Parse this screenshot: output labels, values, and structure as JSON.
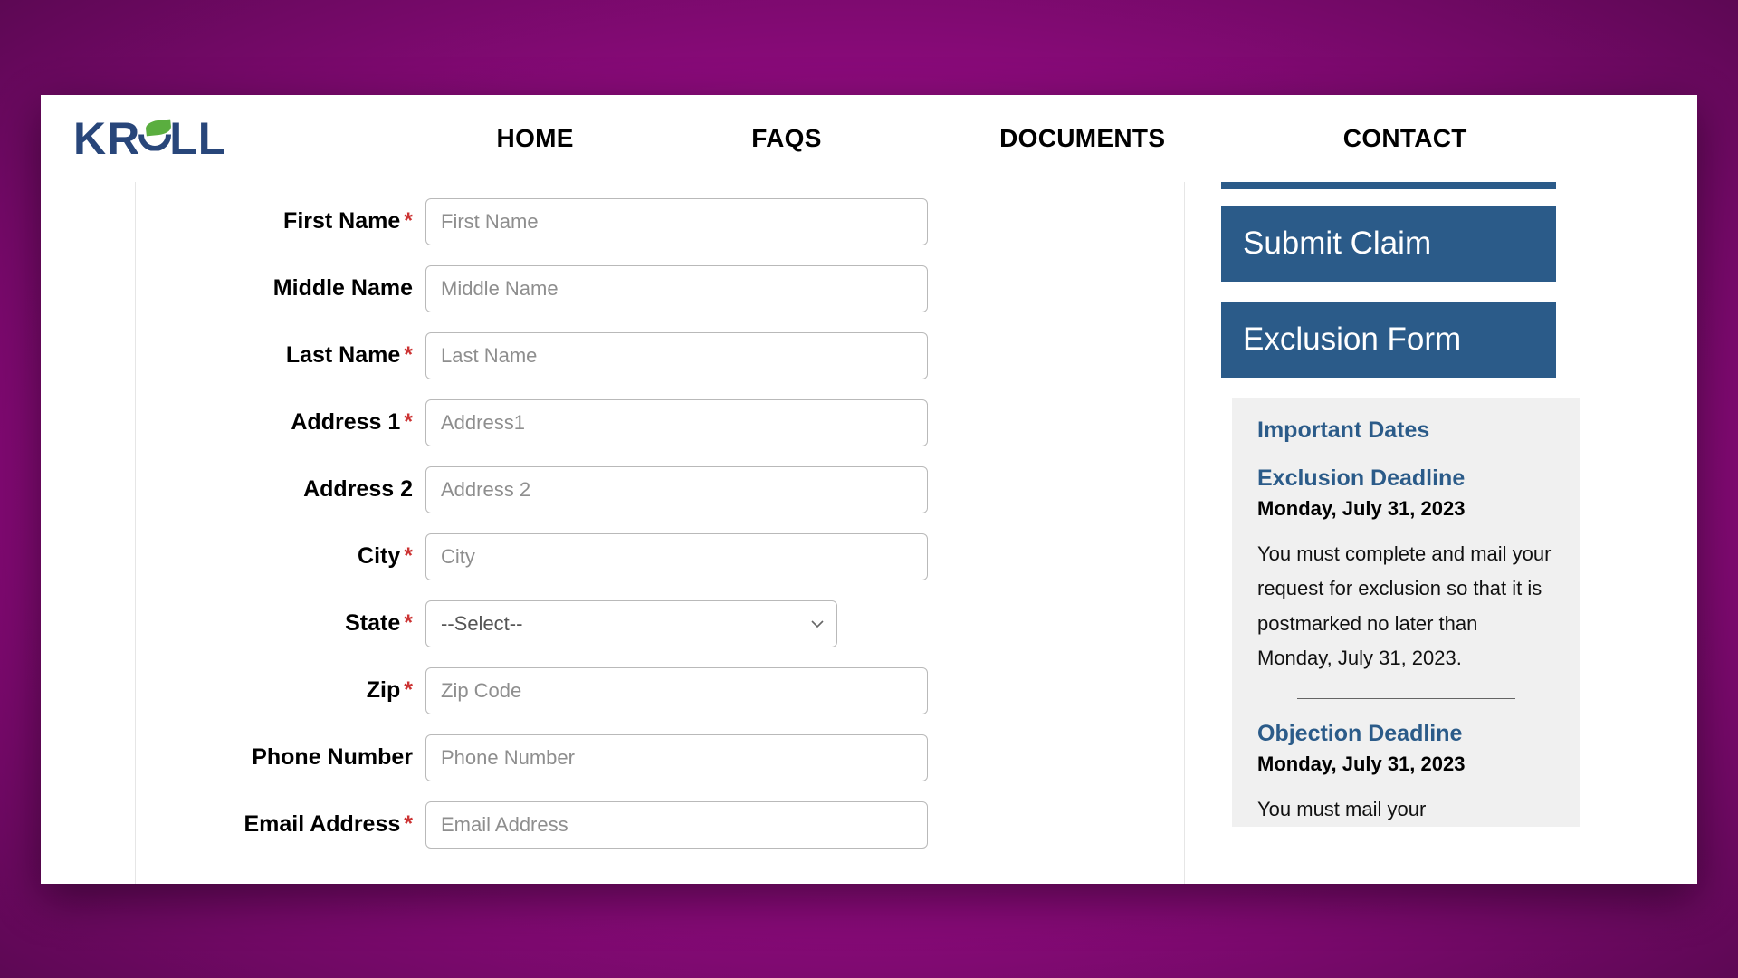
{
  "brand": "KROLL",
  "nav": {
    "home": "HOME",
    "faqs": "FAQS",
    "documents": "DOCUMENTS",
    "contact": "CONTACT"
  },
  "form": {
    "firstName": {
      "label": "First Name",
      "placeholder": "First Name",
      "required": true
    },
    "middleName": {
      "label": "Middle Name",
      "placeholder": "Middle Name",
      "required": false
    },
    "lastName": {
      "label": "Last Name",
      "placeholder": "Last Name",
      "required": true
    },
    "address1": {
      "label": "Address 1",
      "placeholder": "Address1",
      "required": true
    },
    "address2": {
      "label": "Address 2",
      "placeholder": "Address 2",
      "required": false
    },
    "city": {
      "label": "City",
      "placeholder": "City",
      "required": true
    },
    "state": {
      "label": "State",
      "placeholder": "--Select--",
      "required": true
    },
    "zip": {
      "label": "Zip",
      "placeholder": "Zip Code",
      "required": true
    },
    "phone": {
      "label": "Phone Number",
      "placeholder": "Phone Number",
      "required": false
    },
    "email": {
      "label": "Email Address",
      "placeholder": "Email Address",
      "required": true
    }
  },
  "sidebar": {
    "submitClaim": "Submit Claim",
    "exclusionForm": "Exclusion Form",
    "datesTitle": "Important Dates",
    "exclusion": {
      "heading": "Exclusion Deadline",
      "date": "Monday, July 31, 2023",
      "desc": "You must complete and mail your request for exclusion so that it is postmarked no later than Monday, July 31, 2023."
    },
    "objection": {
      "heading": "Objection Deadline",
      "date": "Monday, July 31, 2023",
      "desc": "You must mail your"
    }
  },
  "asterisk": "*"
}
